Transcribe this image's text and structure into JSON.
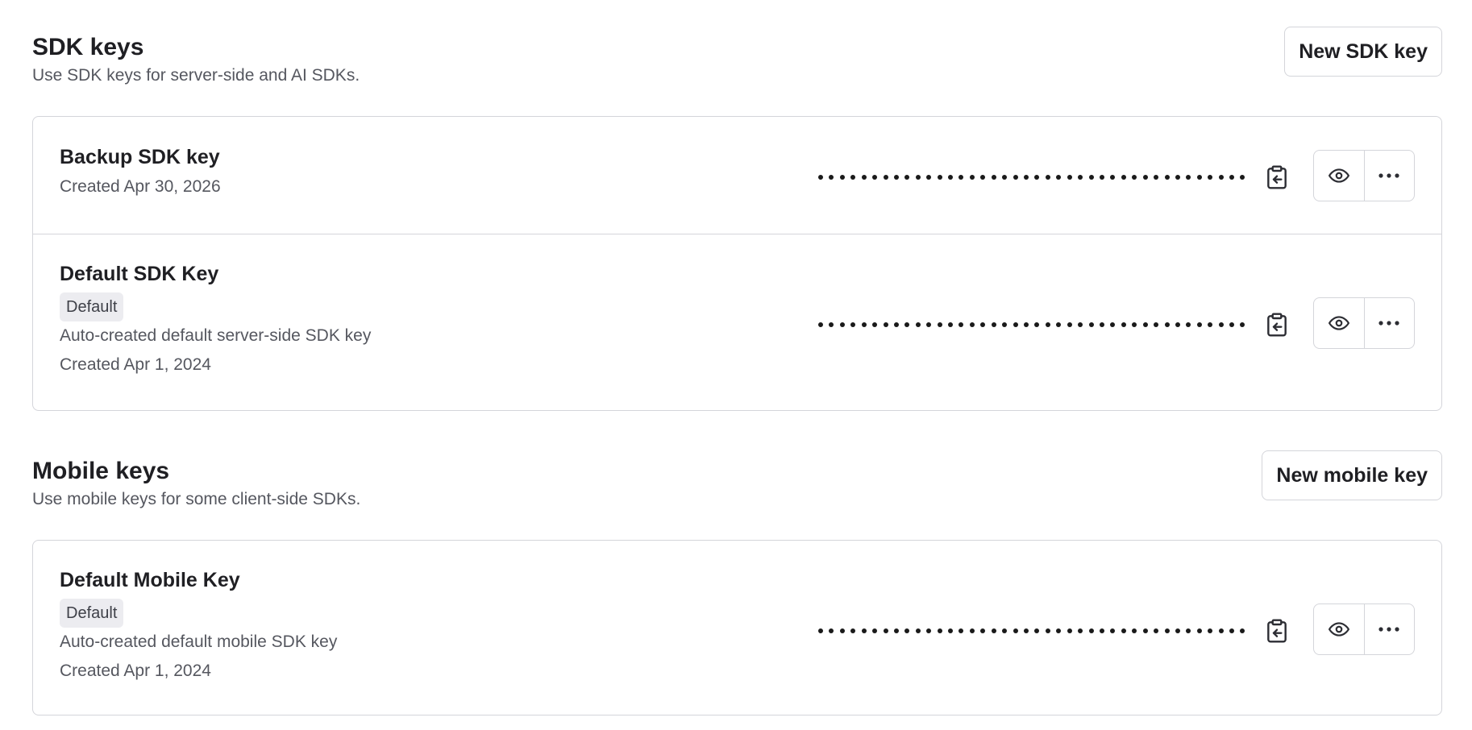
{
  "sdk_section": {
    "title": "SDK keys",
    "description": "Use SDK keys for server-side and AI SDKs.",
    "new_button_label": "New SDK key",
    "keys": [
      {
        "name": "Backup SDK key",
        "badge": "",
        "description": "",
        "created": "Created Apr 30, 2026"
      },
      {
        "name": "Default SDK Key",
        "badge": "Default",
        "description": "Auto-created default server-side SDK key",
        "created": "Created Apr 1, 2024"
      }
    ]
  },
  "mobile_section": {
    "title": "Mobile keys",
    "description": "Use mobile keys for some client-side SDKs.",
    "new_button_label": "New mobile key",
    "keys": [
      {
        "name": "Default Mobile Key",
        "badge": "Default",
        "description": "Auto-created default mobile SDK key",
        "created": "Created Apr 1, 2024"
      }
    ]
  },
  "icons": {
    "copy": "clipboard-copy-icon",
    "reveal": "eye-icon",
    "more": "more-horizontal-icon"
  },
  "colors": {
    "border": "#d4d5da",
    "badge_bg": "#ececf0",
    "text_primary": "#1f1f23",
    "text_secondary": "#55575f"
  }
}
